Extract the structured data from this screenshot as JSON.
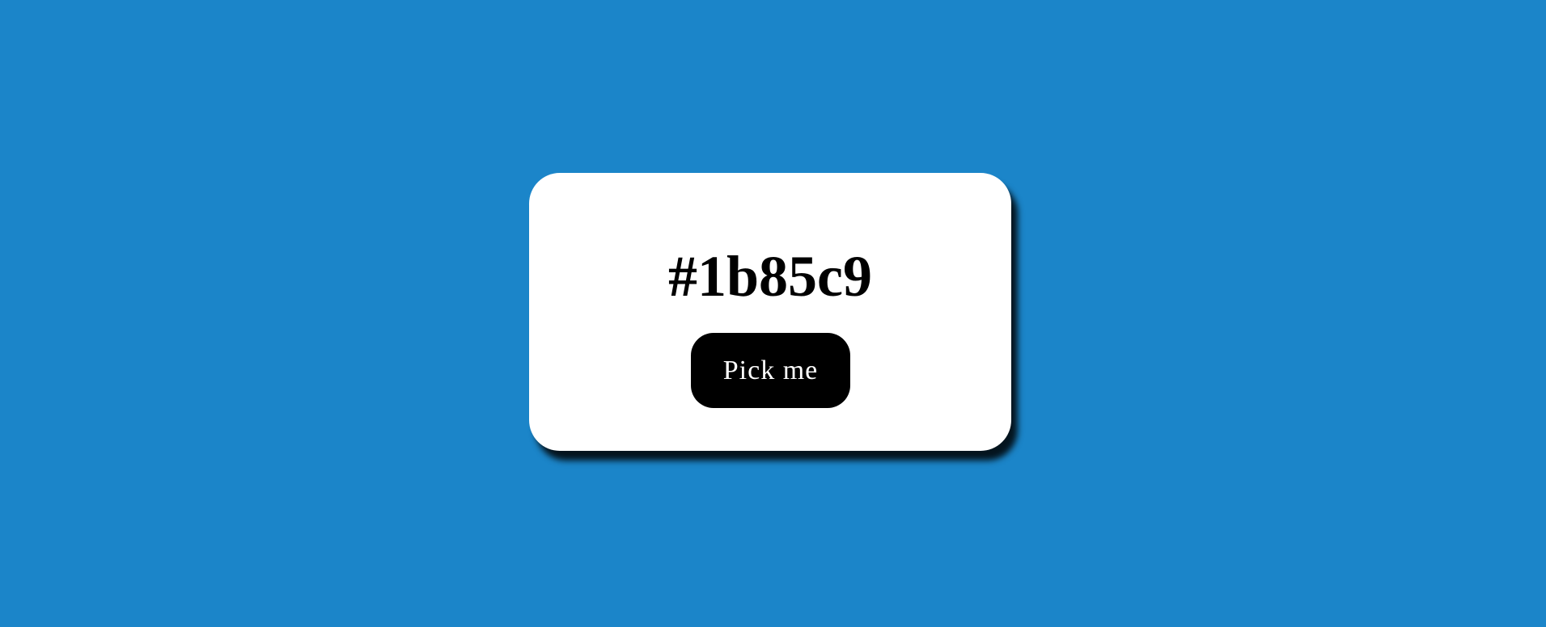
{
  "page": {
    "background_color": "#1b85c9"
  },
  "card": {
    "color_code": "#1b85c9",
    "button_label": "Pick me"
  },
  "colors": {
    "card_background": "#ffffff",
    "button_background": "#000000",
    "button_text": "#ffffff",
    "heading_text": "#000000"
  }
}
